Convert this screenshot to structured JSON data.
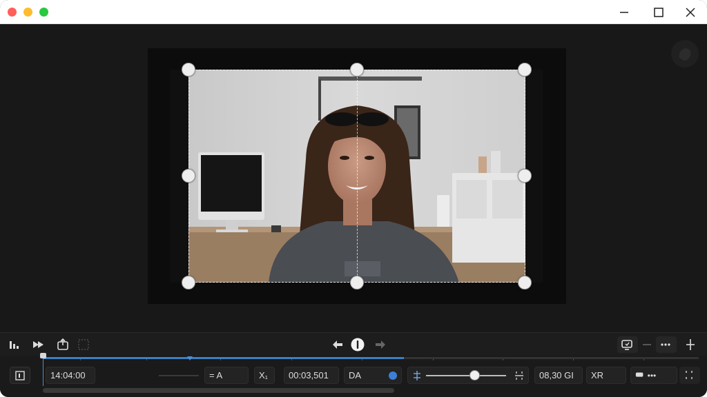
{
  "window": {
    "controls": [
      "close",
      "minimize",
      "zoom"
    ],
    "caption_buttons": [
      "minimize-icon",
      "maximize-icon",
      "close-icon"
    ]
  },
  "preview": {
    "handles": [
      "top-left",
      "top-center",
      "top-right",
      "middle-left",
      "middle-right",
      "bottom-left",
      "bottom-center",
      "bottom-right"
    ]
  },
  "toolbar": {
    "left_icons": [
      "levels-icon",
      "fast-forward-icon",
      "export-icon",
      "grid-icon"
    ],
    "center_icons": [
      "arrow-left-icon",
      "info-icon",
      "arrow-right-icon"
    ],
    "right_icons": [
      "screen-icon",
      "minus-icon",
      "more-icon",
      "split-icon"
    ]
  },
  "timeline": {
    "timecode": "14:04:00",
    "field_a": "= A",
    "field_x": "X₁",
    "duration": "00:03,501",
    "field_da": "DA",
    "field_size": "08,30 GI",
    "field_xr": "XR",
    "field_more": "•••",
    "progress": 0.55,
    "slider_value": 0.6
  },
  "colors": {
    "accent": "#3d7fd6",
    "background": "#1a1a1a"
  }
}
